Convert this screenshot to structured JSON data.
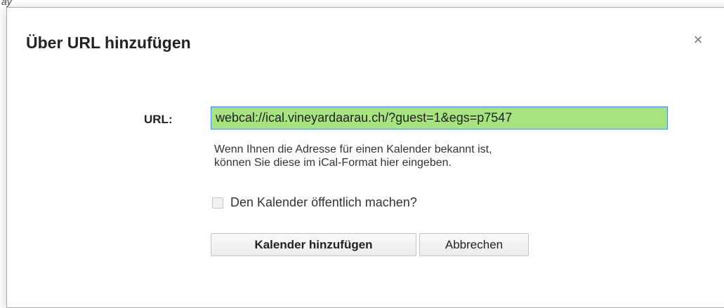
{
  "background": {
    "partial_text": "ay"
  },
  "dialog": {
    "title": "Über URL hinzufügen",
    "close_symbol": "×",
    "url_label": "URL:",
    "url_value": "webcal://ical.vineyardaarau.ch/?guest=1&egs=p7547",
    "hint_line1": "Wenn Ihnen die Adresse für einen Kalender bekannt ist,",
    "hint_line2": "können Sie diese im iCal-Format hier eingeben.",
    "public_checkbox_label": "Den Kalender öffentlich machen?",
    "public_checked": false,
    "add_button_label": "Kalender hinzufügen",
    "cancel_button_label": "Abbrechen"
  },
  "colors": {
    "url_input_bg": "#a6e47f",
    "focus_border": "#4d90fe"
  },
  "icons": {
    "close": "close-icon"
  }
}
